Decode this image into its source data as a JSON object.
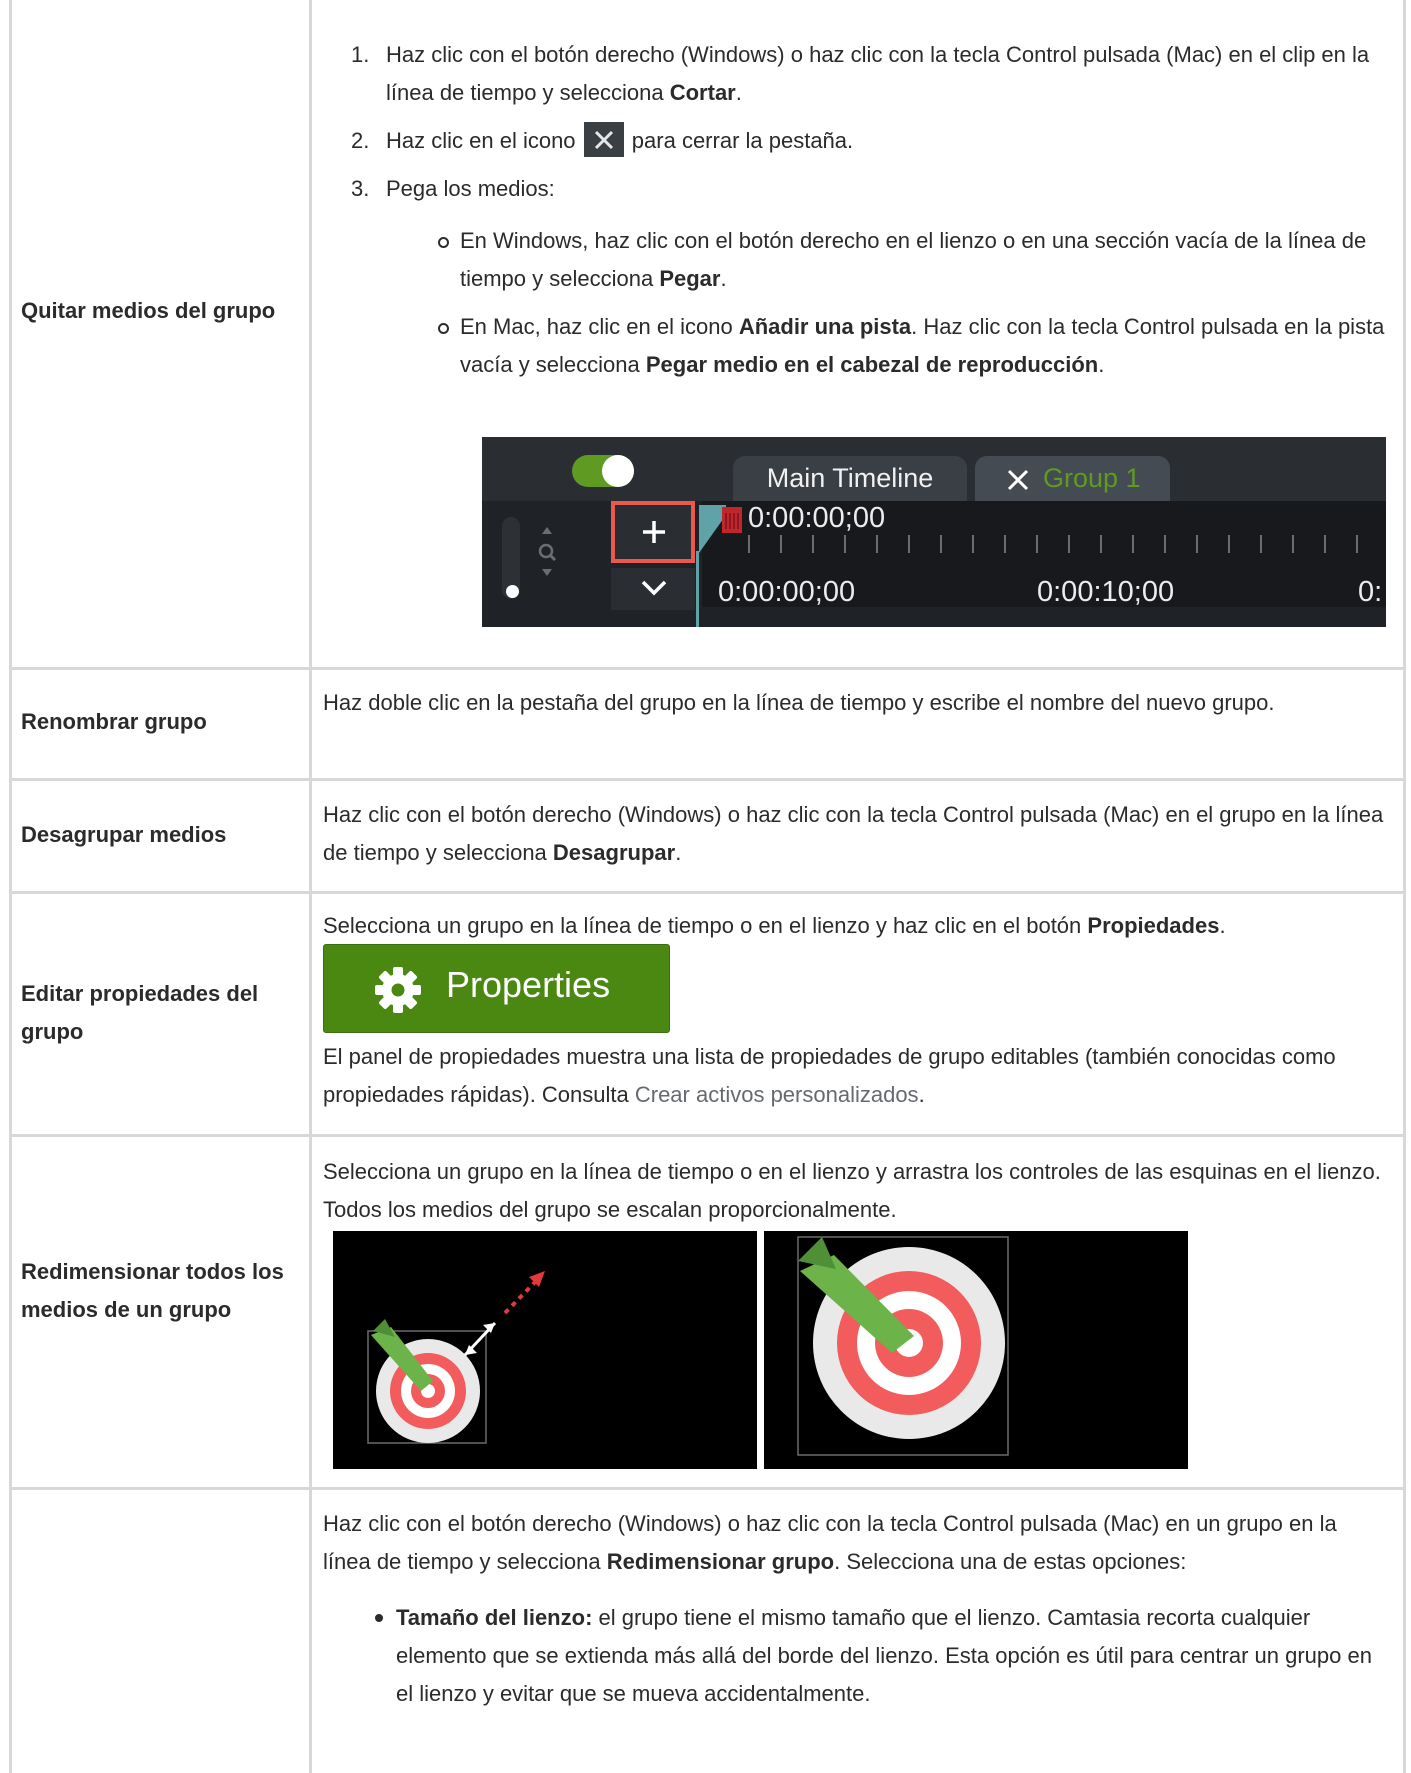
{
  "rows": [
    {
      "label": "Quitar medios del grupo",
      "steps": [
        {
          "num": "1.",
          "pre": "Haz clic con el botón derecho (Windows) o haz clic con la tecla Control pulsada (Mac) en el clip en la línea de tiempo y selecciona ",
          "bold": "Cortar",
          "post": "."
        },
        {
          "num": "2.",
          "pre": "Haz clic en el icono",
          "icon": "close-x-icon",
          "post": "para cerrar la pestaña."
        },
        {
          "num": "3.",
          "text": "Pega los medios:"
        }
      ],
      "sub_items": [
        {
          "pre": "En Windows, haz clic con el botón derecho en el lienzo o en una sección vacía de la línea de tiempo y selecciona ",
          "bold": "Pegar",
          "post": "."
        },
        {
          "pre": "En Mac, haz clic en el icono ",
          "bold1": "Añadir una pista",
          "mid": ". Haz clic con la tecla Control pulsada en la pista vacía y selecciona ",
          "bold2": "Pegar medio en el cabezal de reproducción",
          "post": "."
        }
      ],
      "timeline": {
        "tab_main": "Main Timeline",
        "tab_group": "Group 1",
        "playhead_time": "0:00:00;00",
        "ruler_labels": [
          "0:00:00;00",
          "0:00:10;00",
          "0:"
        ],
        "toggle_on": true,
        "highlight_color": "#e85a4f",
        "group_tab_color": "#5f9a23"
      }
    },
    {
      "label": "Renombrar grupo",
      "text": "Haz doble clic en la pestaña del grupo en la línea de tiempo y escribe el nombre del nuevo grupo."
    },
    {
      "label": "Desagrupar medios",
      "pre": "Haz clic con el botón derecho (Windows) o haz clic con la tecla Control pulsada (Mac) en el grupo en la línea de tiempo y selecciona ",
      "bold": "Desagrupar",
      "post": "."
    },
    {
      "label": "Editar propiedades del grupo",
      "pre": "Selecciona un grupo en la línea de tiempo o en el lienzo y haz clic en el botón ",
      "bold": "Propiedades",
      "post": ".",
      "button_label": "Properties",
      "button_color": "#4a8811",
      "after_pre": "El panel de propiedades muestra una lista de propiedades de grupo editables (también conocidas como propiedades rápidas). Consulta ",
      "link": "Crear activos personalizados",
      "after_post": "."
    },
    {
      "label": "Redimensionar todos los medios de un grupo",
      "text": "Selecciona un grupo en la línea de tiempo o en el lienzo y arrastra los controles de las esquinas en el lienzo. Todos los medios del grupo se escalan proporcionalmente."
    },
    {
      "label": "",
      "pre": "Haz clic con el botón derecho (Windows) o haz clic con la tecla Control pulsada (Mac) en un grupo en la línea de tiempo y selecciona ",
      "bold": "Redimensionar grupo",
      "post": ". Selecciona una de estas opciones:",
      "bullets": [
        {
          "bold": "Tamaño del lienzo:",
          "text": " el grupo tiene el mismo tamaño que el lienzo. Camtasia recorta cualquier elemento que se extienda más allá del borde del lienzo. Esta opción es útil para centrar un grupo en el lienzo y evitar que se mueva accidentalmente."
        }
      ]
    }
  ]
}
